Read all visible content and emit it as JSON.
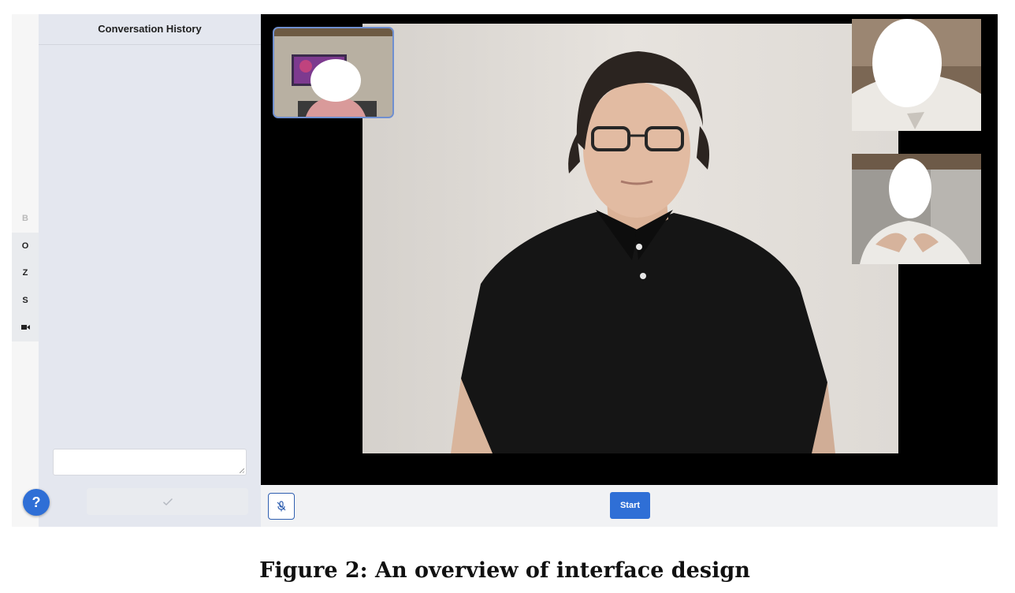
{
  "history": {
    "title": "Conversation History",
    "input_value": "",
    "send_icon": "check-icon"
  },
  "rail": {
    "items": [
      {
        "label": "B",
        "state": "disabled"
      },
      {
        "label": "O",
        "state": "enabled"
      },
      {
        "label": "Z",
        "state": "enabled"
      },
      {
        "label": "S",
        "state": "enabled"
      },
      {
        "label": "",
        "icon": "video-camera-icon",
        "state": "enabled"
      }
    ]
  },
  "help": {
    "label": "?"
  },
  "controls": {
    "mic_icon": "microphone-muted-icon",
    "start_label": "Start"
  },
  "colors": {
    "accent": "#2f6fd6",
    "stage_background": "#000000",
    "sidebar_background": "#e4e7ef"
  },
  "caption": "Figure 2: An overview of interface design"
}
